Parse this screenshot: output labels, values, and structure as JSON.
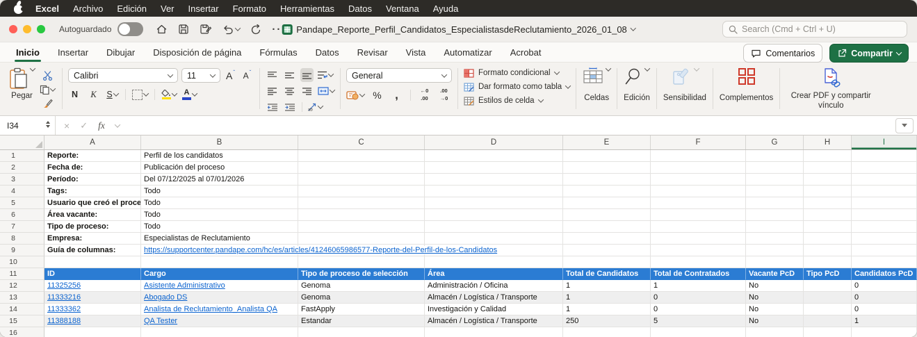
{
  "colors": {
    "accent_green": "#1e7145",
    "table_header_blue": "#2b7cd3",
    "hyperlink_blue": "#0b63cf",
    "banded_row": "#efefef",
    "fill_yellow": "#ffe000",
    "font_color_blue": "#2946c8"
  },
  "menu_bar": {
    "app_name": "Excel",
    "items": [
      "Archivo",
      "Edición",
      "Ver",
      "Insertar",
      "Formato",
      "Herramientas",
      "Datos",
      "Ventana",
      "Ayuda"
    ]
  },
  "title_bar": {
    "autosave_label": "Autoguardado",
    "filename": "Pandape_Reporte_Perfil_Candidatos_EspecialistasdeReclutamiento_2026_01_08",
    "search_placeholder": "Search (Cmd + Ctrl + U)"
  },
  "ribbon_tabs": {
    "items": [
      "Inicio",
      "Insertar",
      "Dibujar",
      "Disposición de página",
      "Fórmulas",
      "Datos",
      "Revisar",
      "Vista",
      "Automatizar",
      "Acrobat"
    ],
    "active": "Inicio",
    "comments_label": "Comentarios",
    "share_label": "Compartir"
  },
  "ribbon": {
    "paste_label": "Pegar",
    "font_name": "Calibri",
    "font_size": "11",
    "bold_label": "N",
    "italic_label": "K",
    "underline_label": "S",
    "number_format": "General",
    "percent_label": "%",
    "comma_label": ",",
    "dec_inc_top": "←0",
    "dec_inc_bottom": ".00",
    "dec_dec_top": ".00",
    "dec_dec_bottom": "→0",
    "styles": [
      "Formato condicional",
      "Dar formato como tabla",
      "Estilos de celda"
    ],
    "cells_label": "Celdas",
    "edit_label": "Edición",
    "sensitivity_label": "Sensibilidad",
    "addins_label": "Complementos",
    "pdf_label": "Crear PDF y compartir vínculo"
  },
  "formula_bar": {
    "name_box": "I34",
    "fx_label": "fx"
  },
  "grid": {
    "columns": [
      "A",
      "B",
      "C",
      "D",
      "E",
      "F",
      "G",
      "H",
      "I"
    ],
    "selected_column": "I",
    "visible_rows": 16
  },
  "sheet": {
    "meta_rows": [
      {
        "row": 1,
        "label": "Reporte:",
        "value": "Perfil de los candidatos"
      },
      {
        "row": 2,
        "label": "Fecha de:",
        "value": "Publicación del proceso"
      },
      {
        "row": 3,
        "label": "Período:",
        "value": "Del 07/12/2025 al 07/01/2026"
      },
      {
        "row": 4,
        "label": "Tags:",
        "value": "Todo"
      },
      {
        "row": 5,
        "label": "Usuario que creó el proceso:",
        "value": "Todo"
      },
      {
        "row": 6,
        "label": "Área vacante:",
        "value": "Todo"
      },
      {
        "row": 7,
        "label": "Tipo de proceso:",
        "value": "Todo"
      },
      {
        "row": 8,
        "label": "Empresa:",
        "value": "Especialistas de Reclutamiento"
      },
      {
        "row": 9,
        "label": "Guía de columnas:",
        "value": "https://supportcenter.pandape.com/hc/es/articles/41246065986577-Reporte-del-Perfil-de-los-Candidatos",
        "link": true
      }
    ],
    "table": {
      "header_row": 11,
      "first_data_row": 12,
      "headers": [
        "ID",
        "Cargo",
        "Tipo de proceso de selección",
        "Área",
        "Total de Candidatos",
        "Total de Contratados",
        "Vacante PcD",
        "Tipo PcD",
        "Candidatos PcD"
      ],
      "link_columns": [
        0,
        1
      ],
      "banded_rows": [
        13,
        15
      ],
      "rows": [
        [
          "11325256",
          "Asistente Administrativo",
          "Genoma",
          "Administración / Oficina",
          "1",
          "1",
          "No",
          "",
          "0"
        ],
        [
          "11333216",
          "Abogado DS",
          "Genoma",
          "Almacén / Logística / Transporte",
          "1",
          "0",
          "No",
          "",
          "0"
        ],
        [
          "11333362",
          "Analista de Reclutamiento_Analista QA",
          "FastApply",
          "Investigación y Calidad",
          "1",
          "0",
          "No",
          "",
          "0"
        ],
        [
          "11388188",
          "QA Tester",
          "Estandar",
          "Almacén / Logística / Transporte",
          "250",
          "5",
          "No",
          "",
          "1"
        ]
      ]
    }
  }
}
